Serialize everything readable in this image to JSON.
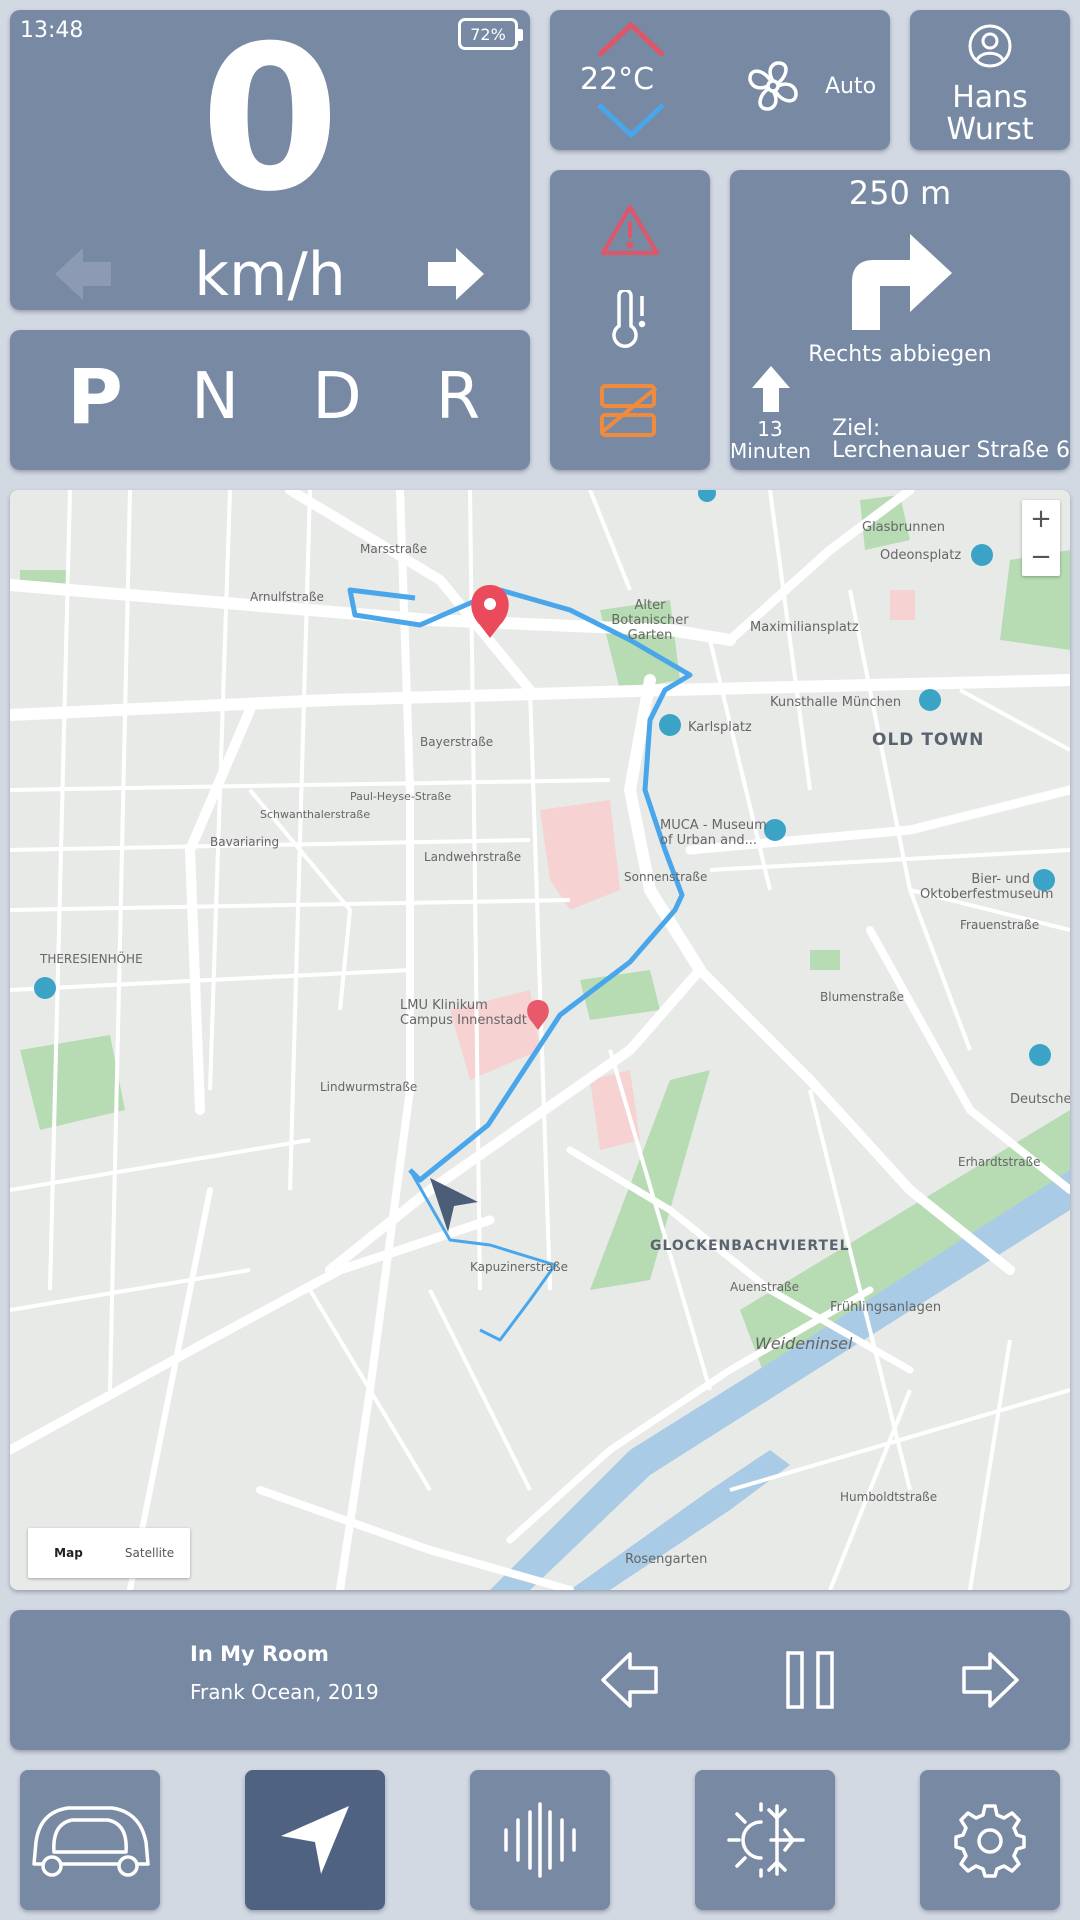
{
  "status": {
    "time": "13:48",
    "battery": "72%"
  },
  "speed": {
    "value": "0",
    "unit": "km/h"
  },
  "gears": [
    "P",
    "N",
    "D",
    "R"
  ],
  "active_gear": "P",
  "climate": {
    "temperature": "22°C",
    "fan_mode": "Auto"
  },
  "profile": {
    "first_name": "Hans",
    "last_name": "Wurst"
  },
  "warnings": [
    "warning-triangle-icon",
    "temperature-warning-icon",
    "battery-disconnected-icon"
  ],
  "navigation": {
    "distance": "250 m",
    "instruction": "Rechts abbiegen",
    "eta_value": "13",
    "eta_unit": "Minuten",
    "destination_label": "Ziel:",
    "destination": "Lerchenauer Straße 6"
  },
  "map": {
    "zoom_in": "+",
    "zoom_out": "−",
    "type_map": "Map",
    "type_satellite": "Satellite",
    "labels": {
      "glasbrunnen": "Glasbrunnen",
      "odeonsplatz": "Odeonsplatz",
      "alter_bot": "Alter Botanischer Garten",
      "maximiliansplatz": "Maximiliansplatz",
      "kunsthalle": "Kunsthalle München",
      "karlsplatz": "Karlsplatz",
      "old_town": "OLD TOWN",
      "muca": "MUCA - Museum of Urban and...",
      "bier": "Bier- und Oktoberfestmuseum",
      "theresienhoehe": "THERESIENHÖHE",
      "lmu": "LMU Klinikum Campus Innenstadt",
      "glockenbach": "GLOCKENBACHVIERTEL",
      "weideninsel": "Weideninsel",
      "fruehling": "Frühlingsanlagen",
      "rosengarten": "Rosengarten",
      "deutsches": "Deutsches M",
      "bayerstr": "Bayerstraße",
      "arnulfstr": "Arnulfstraße",
      "landwehr": "Landwehrstraße",
      "schwanthaler": "Schwanthalerstraße",
      "marsstr": "Marsstraße",
      "lindwurm": "Lindwurmstraße",
      "sonnenstr": "Sonnenstraße",
      "frauenstr": "Frauenstraße",
      "blumenstr": "Blumenstraße",
      "erhardtstr": "Erhardtstraße",
      "kapuziner": "Kapuzinerstraße",
      "humboldt": "Humboldtstraße",
      "auenstr": "Auenstraße",
      "bavariaring": "Bavariaring",
      "paulheyse": "Paul-Heyse-Straße"
    }
  },
  "music": {
    "title": "In My Room",
    "artist_year": "Frank Ocean, 2019"
  },
  "bottom_nav": [
    "car-icon",
    "navigation-arrow-icon",
    "sound-wave-icon",
    "climate-icon",
    "settings-gear-icon"
  ],
  "colors": {
    "panel": "#7889a4",
    "background": "#d2d9e3",
    "active": "#4f6282",
    "route": "#4aa6ea",
    "temp_up": "#e05567",
    "temp_down": "#4aa6ea",
    "alert_red": "#e05567",
    "alert_orange": "#f08a3c"
  }
}
